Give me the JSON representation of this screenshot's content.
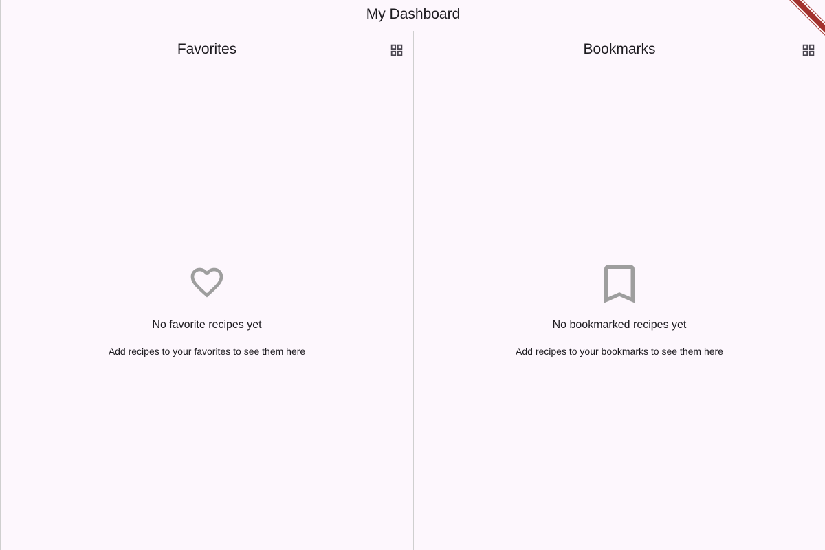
{
  "app": {
    "title": "My Dashboard"
  },
  "panes": [
    {
      "title": "Favorites",
      "toggle_icon": "grid-view-icon",
      "empty_icon": "heart-outline-icon",
      "empty_title": "No favorite recipes yet",
      "empty_subtitle": "Add recipes to your favorites to see them here"
    },
    {
      "title": "Bookmarks",
      "toggle_icon": "grid-view-icon",
      "empty_icon": "bookmark-outline-icon",
      "empty_subtitle": "Add recipes to your bookmarks to see them here",
      "empty_title": "No bookmarked recipes yet"
    }
  ],
  "colors": {
    "background": "#fdf7fd",
    "text": "#1d1b20",
    "icon_muted": "#9e9e9e",
    "icon_dark": "#49454f",
    "divider": "#cfcfcf",
    "debug_banner": "#a3322e"
  }
}
